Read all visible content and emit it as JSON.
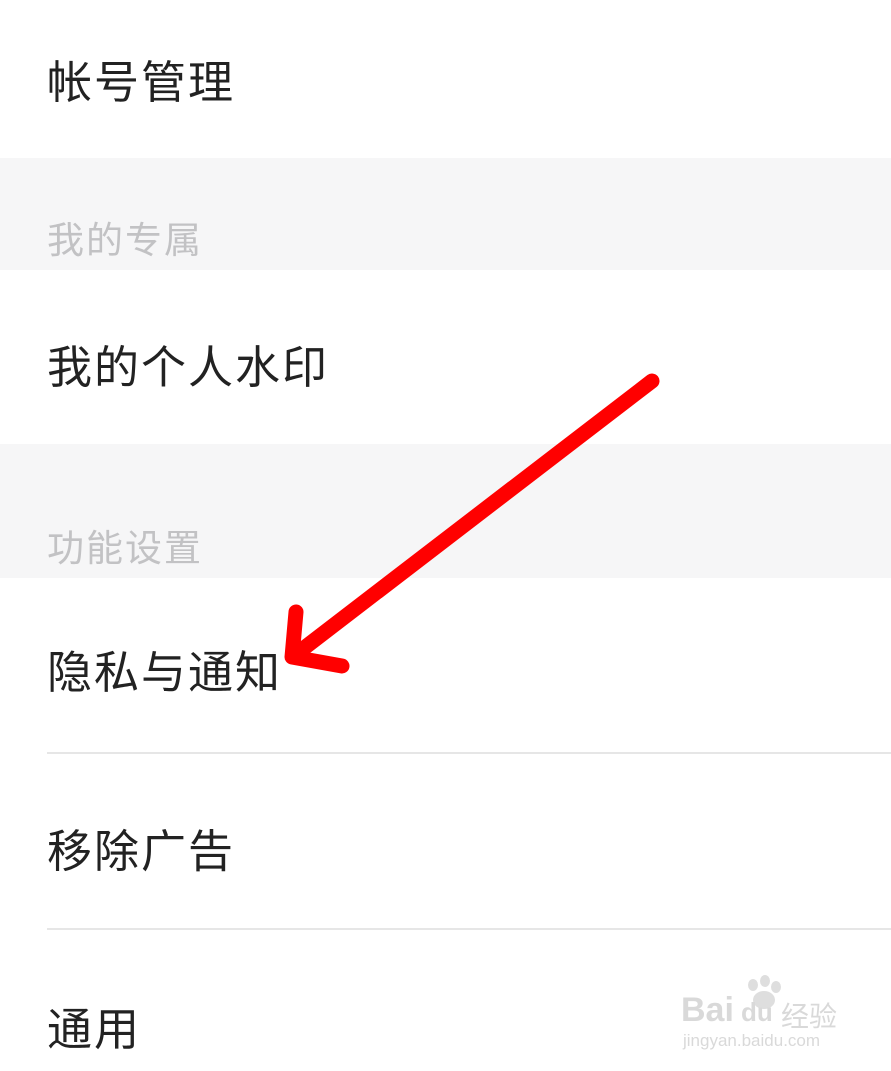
{
  "rows": {
    "account": "帐号管理",
    "watermark": "我的个人水印",
    "privacy": "隐私与通知",
    "remove_ads": "移除广告",
    "general": "通用"
  },
  "sections": {
    "exclusive": "我的专属",
    "features": "功能设置"
  },
  "annotation": {
    "arrow_color": "#ff0000"
  },
  "brand_watermark": {
    "logo": "Bai",
    "logo_suffix": "du",
    "cn": "经验",
    "url": "jingyan.baidu.com"
  }
}
